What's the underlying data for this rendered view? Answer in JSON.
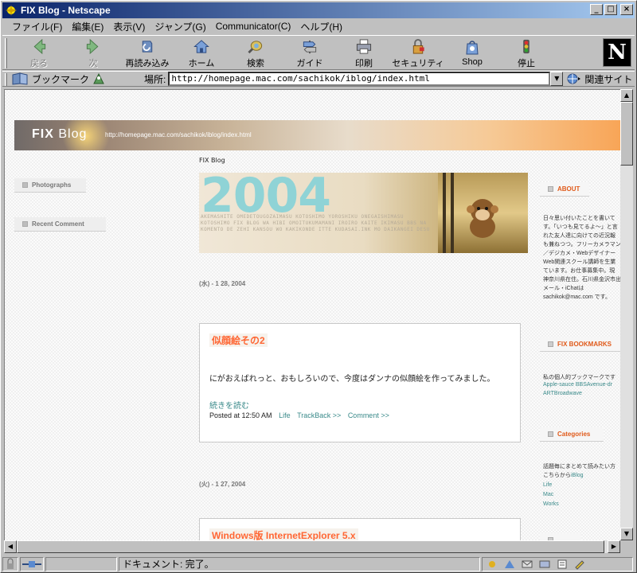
{
  "window": {
    "title": "FIX Blog - Netscape",
    "controls": {
      "minimize": "_",
      "maximize": "□",
      "close": "×"
    }
  },
  "menu": [
    "ファイル(F)",
    "編集(E)",
    "表示(V)",
    "ジャンプ(G)",
    "Communicator(C)",
    "ヘルプ(H)"
  ],
  "toolbar": {
    "back": "戻る",
    "forward": "次",
    "reload": "再読み込み",
    "home": "ホーム",
    "search": "検索",
    "guide": "ガイド",
    "print": "印刷",
    "security": "セキュリティ",
    "shop": "Shop",
    "stop": "停止",
    "logo": "N"
  },
  "location": {
    "bookmarks": "ブックマーク",
    "label": "場所:",
    "url": "http://homepage.mac.com/sachikok/iblog/index.html",
    "related": "関連サイト"
  },
  "status": {
    "text": "ドキュメント: 完了。"
  },
  "page": {
    "banner_title_bold": "FIX",
    "banner_title_rest": " Blog",
    "banner_url": "http://homepage.mac.com/sachikok/iblog/index.html",
    "breadcrumb": "FIX Blog",
    "left_sidebar": [
      "Photographs",
      "Recent Comment"
    ],
    "hero_year": "2004",
    "hero_text": "AKEMASHITE OMEDETOUGOZAIMASU KOTOSHIMO YOROSHIKU ONEGAISHIMASU KOTOSHIMO FIX BLOG WA HIBI OMOITUKUMAMANI IROIRO KAITE IKIMASU BBS NA KOMENTO DE ZEHI KANSOU WO KAKIKONDE ITTE KUDASAI.INK MO DAIKANGEI DESU",
    "posts": [
      {
        "date": "(水) - 1 28, 2004",
        "title": "似顔絵その2",
        "body": "にがおえばれっと、おもしろいので、今度はダンナの似顔絵を作ってみました。",
        "more": "続きを読む",
        "posted": "Posted at 12:50 AM",
        "links": [
          "Life",
          "TrackBack >>",
          "Comment >>"
        ]
      },
      {
        "date": "(火) - 1 27, 2004",
        "title": "Windows版 InternetExplorer 5.x"
      }
    ],
    "right_sidebar": {
      "about_head": "ABOUT",
      "about_lines": [
        "日々思い付いたことを書いて",
        "す。「いつも見てるよ～」と言",
        "れた友人達に向けての近況報",
        "も兼ねつつ。フリーカメラマン",
        "／デジカメ・Webデザイナー",
        "Web関連スクール講師を生業",
        "ています。お仕事募集中。現",
        "神奈川県在住。石川県金沢市出",
        "メール・iChatは",
        "sachikok@mac.com です。"
      ],
      "bookmarks_head": "FIX BOOKMARKS",
      "bookmarks_text": "私の個人的ブックマークです",
      "bookmarks_links": [
        "Apple-sauce BBSAvenue-dr",
        "ARTBroadwave"
      ],
      "categories_head": "Categories",
      "categories_lines": [
        "話題毎にまとめて読みたい方",
        "こちらから"
      ],
      "categories_inline": "iBlog",
      "categories_links": [
        "Life",
        "Mac",
        "Works"
      ]
    }
  }
}
